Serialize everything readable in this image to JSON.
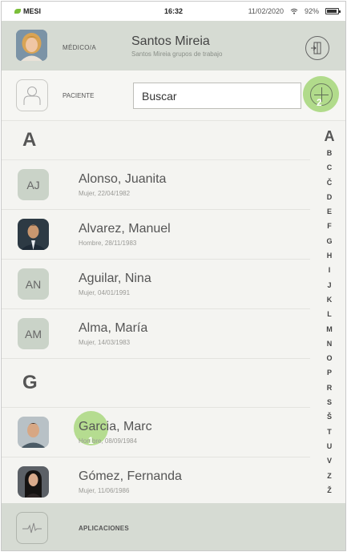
{
  "status": {
    "brand": "MESI",
    "time": "16:32",
    "date": "11/02/2020",
    "battery": "92%"
  },
  "doctor": {
    "role": "MÉDICO/A",
    "name": "Santos Mireia",
    "subtitle": "Santos Mireia grupos de trabajo",
    "logout_icon": "logout-icon"
  },
  "patient": {
    "label": "PACIENTE",
    "search_placeholder": "Buscar",
    "add_marker": "2"
  },
  "sections": [
    {
      "letter": "A",
      "patients": [
        {
          "name": "Alonso, Juanita",
          "info": "Mujer, 22/04/1982",
          "initials": "AJ"
        },
        {
          "name": "Alvarez, Manuel",
          "info": "Hombre, 28/11/1983",
          "photo": "man-1"
        },
        {
          "name": "Aguilar, Nina",
          "info": "Mujer, 04/01/1991",
          "initials": "AN"
        },
        {
          "name": "Alma, María",
          "info": "Mujer, 14/03/1983",
          "initials": "AM"
        }
      ]
    },
    {
      "letter": "G",
      "patients": [
        {
          "name": "Garcia, Marc",
          "info": "Hombre, 08/09/1984",
          "photo": "man-2",
          "tap_marker": "1"
        },
        {
          "name": "Gómez, Fernanda",
          "info": "Mujer, 11/06/1986",
          "photo": "woman-1"
        }
      ]
    }
  ],
  "alphabet_current": "A",
  "alphabet": [
    "B",
    "C",
    "Č",
    "D",
    "E",
    "F",
    "G",
    "H",
    "I",
    "J",
    "K",
    "L",
    "M",
    "N",
    "O",
    "P",
    "R",
    "S",
    "Š",
    "T",
    "U",
    "V",
    "Z",
    "Ž"
  ],
  "footer": {
    "label": "APLICACIONES",
    "icon": "ecg-pulse-icon"
  }
}
